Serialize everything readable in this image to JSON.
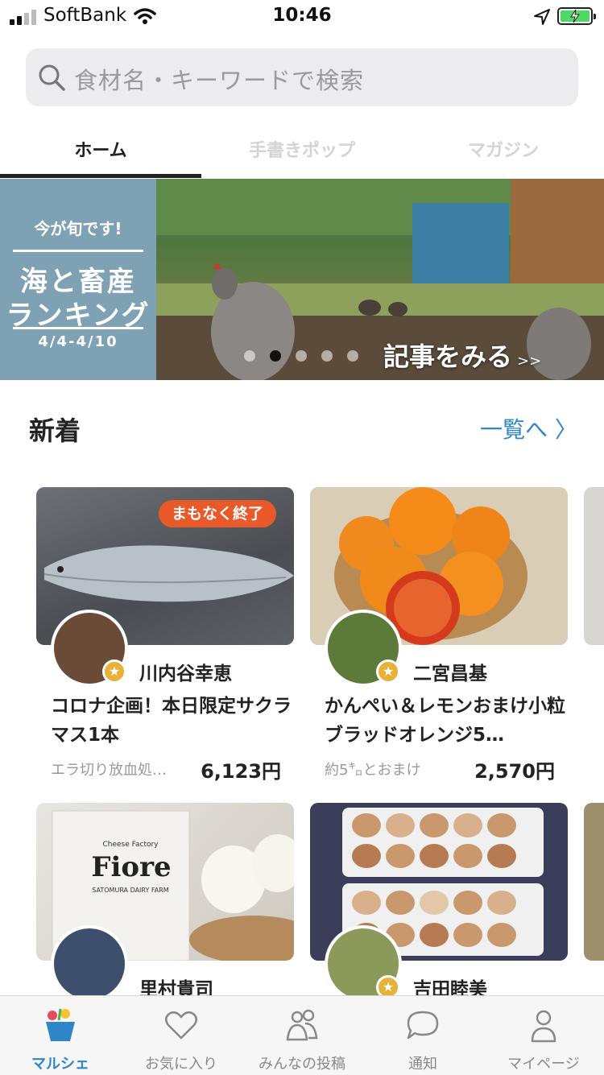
{
  "status_bar": {
    "carrier": "SoftBank",
    "time": "10:46"
  },
  "search": {
    "placeholder": "食材名・キーワードで検索"
  },
  "tabs": [
    {
      "label": "ホーム",
      "active": true
    },
    {
      "label": "手書きポップ",
      "active": false
    },
    {
      "label": "マガジン",
      "active": false
    }
  ],
  "banner": {
    "season_text": "今が旬です!",
    "title_line1": "海と畜産",
    "title_line2": "ランキング",
    "dates": "4/4-4/10",
    "cta": "記事をみる",
    "cta_arrow": ">>",
    "active_dot": 1,
    "dot_count": 5
  },
  "section": {
    "title": "新着",
    "link": "一覧へ 〉"
  },
  "products": [
    {
      "farmer": "川内谷幸恵",
      "title": "コロナ企画！本日限定サクラマス1本",
      "subtitle": "エラ切り放血処…",
      "price": "6,123円",
      "badge": "まもなく終了"
    },
    {
      "farmer": "二宮昌基",
      "title": "かんぺい＆レモンおまけ小粒ブラッドオレンジ5…",
      "subtitle": "約5㌔とおまけ",
      "price": "2,570円"
    },
    {
      "farmer": "里村貴司",
      "image_text_brand": "Fiore",
      "image_text_maker": "Cheese Factory",
      "image_text_farm": "SATOMURA DAIRY FARM"
    },
    {
      "farmer": "吉田睦美"
    }
  ],
  "bottom_nav": [
    {
      "label": "マルシェ",
      "icon": "marche-basket-icon",
      "active": true
    },
    {
      "label": "お気に入り",
      "icon": "heart-icon",
      "active": false
    },
    {
      "label": "みんなの投稿",
      "icon": "people-icon",
      "active": false
    },
    {
      "label": "通知",
      "icon": "chat-bubble-icon",
      "active": false
    },
    {
      "label": "マイページ",
      "icon": "person-icon",
      "active": false
    }
  ],
  "colors": {
    "accent": "#2d86c9",
    "badge": "#e9592a",
    "banner_panel": "#7ea2b3",
    "battery": "#4cd964"
  }
}
